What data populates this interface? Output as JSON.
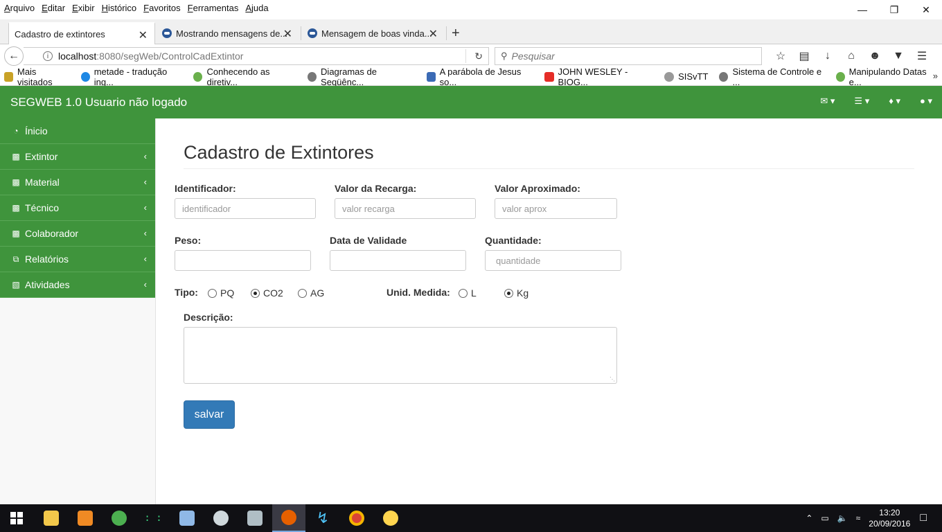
{
  "browser": {
    "menu": [
      {
        "acc": "A",
        "rest": "rquivo"
      },
      {
        "acc": "E",
        "rest": "ditar"
      },
      {
        "acc": "E",
        "rest": "xibir"
      },
      {
        "acc": "H",
        "rest": "istórico"
      },
      {
        "acc": "F",
        "rest": "avoritos"
      },
      {
        "acc": "F",
        "rest": "erramentas"
      },
      {
        "acc": "A",
        "rest": "juda"
      }
    ],
    "tabs": [
      {
        "label": "Cadastro de extintores"
      },
      {
        "label": "Mostrando mensagens de..."
      },
      {
        "label": "Mensagem de boas vinda..."
      }
    ],
    "url_host": "localhost",
    "url_rest": ":8080/segWeb/ControlCadExtintor",
    "search_placeholder": "Pesquisar",
    "bookmarks": [
      {
        "label": "Mais visitados",
        "color": "#c9a227"
      },
      {
        "label": "metade - tradução ing...",
        "color": "#1e88e5"
      },
      {
        "label": "Conhecendo as diretiv...",
        "color": "#6ab04c"
      },
      {
        "label": "Diagramas de Seqüênc...",
        "color": "#777777"
      },
      {
        "label": "A parábola de Jesus so...",
        "color": "#3b6bb5"
      },
      {
        "label": "JOHN WESLEY - BIOG...",
        "color": "#e52d27"
      },
      {
        "label": "SISvTT",
        "color": "#999999"
      },
      {
        "label": "Sistema de Controle e ...",
        "color": "#777777"
      },
      {
        "label": "Manipulando Datas e...",
        "color": "#6ab04c"
      }
    ],
    "bookmarks_more": "»"
  },
  "app": {
    "brand": "SEGWEB 1.0 Usuario não logado",
    "header_icons": [
      "envelope-icon",
      "tasks-icon",
      "bell-icon",
      "user-icon"
    ],
    "sidebar": [
      {
        "label": "Ínicio",
        "icon": "dashboard-icon",
        "chevron": false
      },
      {
        "label": "Extintor",
        "icon": "bar-chart-icon",
        "chevron": true
      },
      {
        "label": "Material",
        "icon": "bar-chart-icon",
        "chevron": true
      },
      {
        "label": "Técnico",
        "icon": "bar-chart-icon",
        "chevron": true
      },
      {
        "label": "Colaborador",
        "icon": "bar-chart-icon",
        "chevron": true
      },
      {
        "label": "Relatórios",
        "icon": "copy-icon",
        "chevron": true
      },
      {
        "label": "Atividades",
        "icon": "sitemap-icon",
        "chevron": true
      }
    ],
    "page_title": "Cadastro de Extintores",
    "form": {
      "identificador_label": "Identificador:",
      "identificador_placeholder": "identificador",
      "recarga_label": "Valor da Recarga:",
      "recarga_placeholder": "valor recarga",
      "aprox_label": "Valor Aproximado:",
      "aprox_placeholder": "valor aprox",
      "peso_label": "Peso:",
      "validade_label": "Data de Validade",
      "quantidade_label": "Quantidade:",
      "quantidade_placeholder": "quantidade",
      "tipo_label": "Tipo:",
      "tipo_options": [
        {
          "label": "PQ",
          "checked": false
        },
        {
          "label": "CO2",
          "checked": true
        },
        {
          "label": "AG",
          "checked": false
        }
      ],
      "unid_label": "Unid. Medida:",
      "unid_options": [
        {
          "label": "L",
          "checked": false
        },
        {
          "label": "Kg",
          "checked": true
        }
      ],
      "descricao_label": "Descrição:",
      "save_label": "salvar"
    }
  },
  "taskbar": {
    "time": "13:20",
    "date": "20/09/2016"
  }
}
